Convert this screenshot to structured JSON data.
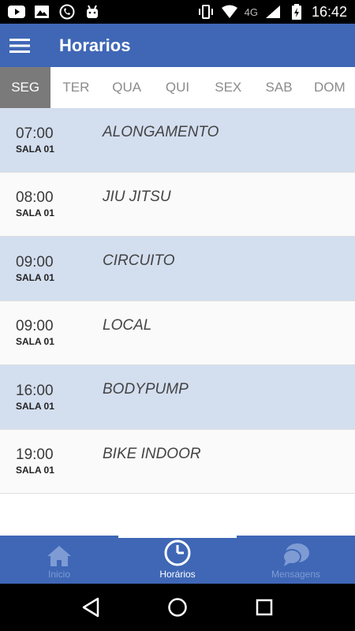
{
  "status_bar": {
    "network": "4G",
    "time": "16:42"
  },
  "app_bar": {
    "title": "Horarios"
  },
  "tabs": [
    {
      "label": "SEG",
      "active": true
    },
    {
      "label": "TER",
      "active": false
    },
    {
      "label": "QUA",
      "active": false
    },
    {
      "label": "QUI",
      "active": false
    },
    {
      "label": "SEX",
      "active": false
    },
    {
      "label": "SAB",
      "active": false
    },
    {
      "label": "DOM",
      "active": false
    }
  ],
  "schedule": [
    {
      "time": "07:00",
      "room": "SALA 01",
      "name": "ALONGAMENTO"
    },
    {
      "time": "08:00",
      "room": "SALA 01",
      "name": "JIU JITSU"
    },
    {
      "time": "09:00",
      "room": "SALA 01",
      "name": "CIRCUITO"
    },
    {
      "time": "09:00",
      "room": "SALA 01",
      "name": "LOCAL"
    },
    {
      "time": "16:00",
      "room": "SALA 01",
      "name": "BODYPUMP"
    },
    {
      "time": "19:00",
      "room": "SALA 01",
      "name": "BIKE INDOOR"
    }
  ],
  "bottom_nav": [
    {
      "label": "Inicio",
      "icon": "home-icon",
      "active": false
    },
    {
      "label": "Horários",
      "icon": "clock-icon",
      "active": true
    },
    {
      "label": "Mensagens",
      "icon": "chat-icon",
      "active": false
    }
  ],
  "colors": {
    "primary": "#3f67b6",
    "row_shade": "#d3deef",
    "tab_active": "#7a7a7a"
  }
}
